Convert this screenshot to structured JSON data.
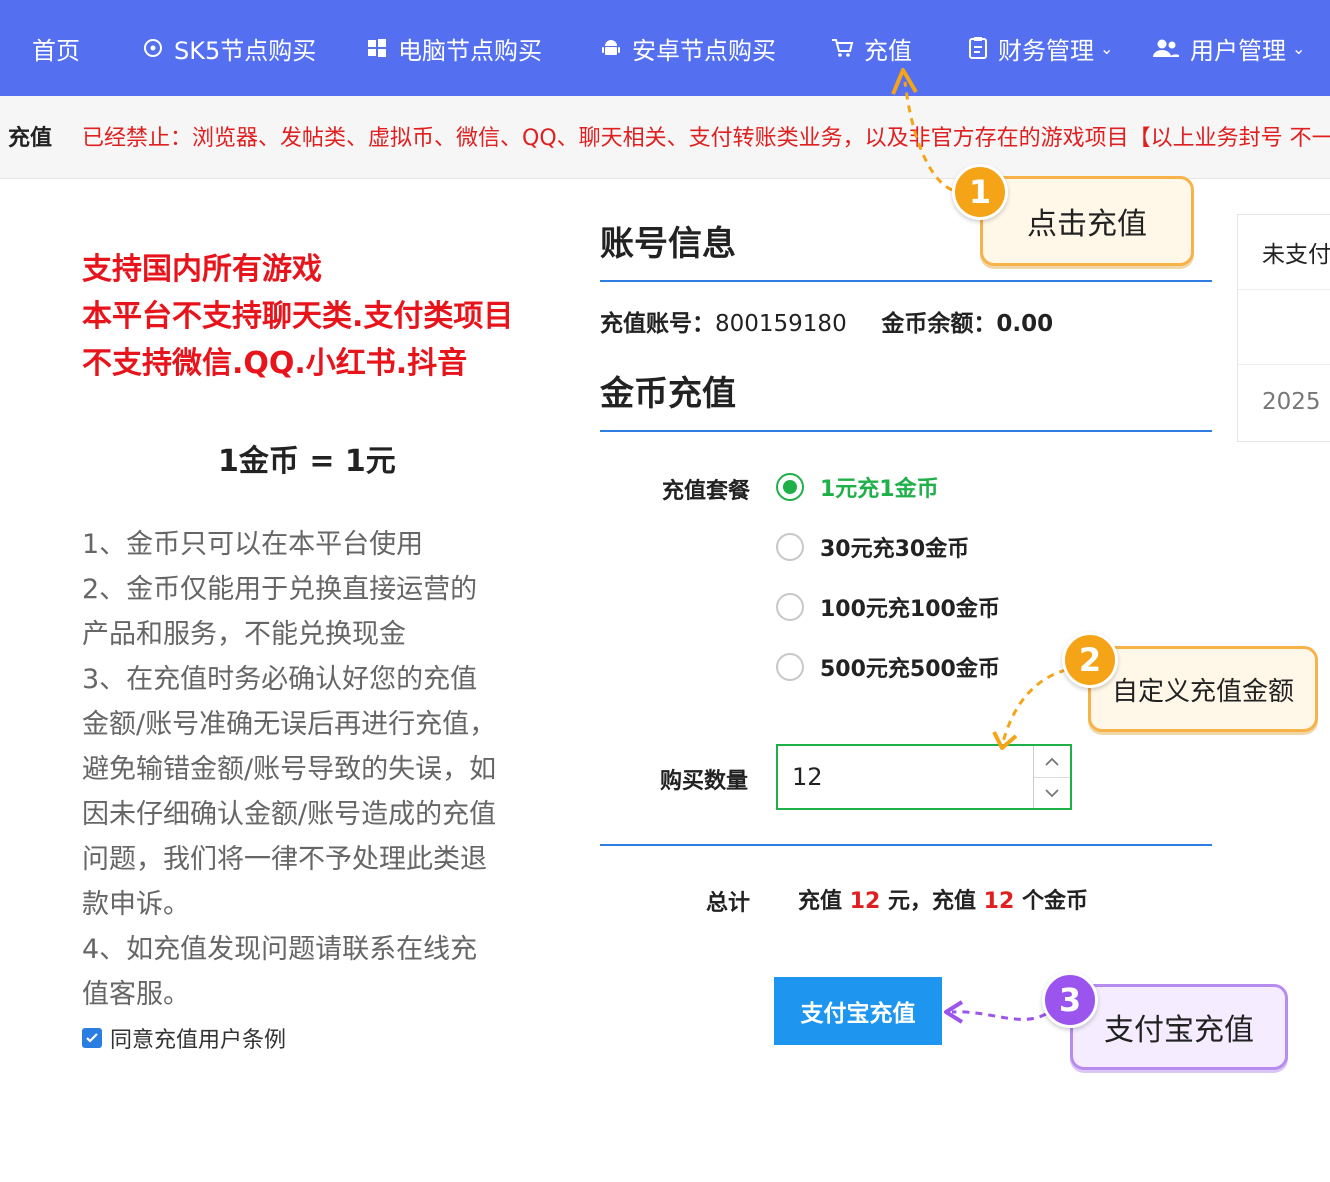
{
  "nav": {
    "items": [
      {
        "label": "首页",
        "icon": ""
      },
      {
        "label": "SK5节点购买",
        "icon": "sync-icon"
      },
      {
        "label": "电脑节点购买",
        "icon": "windows-icon"
      },
      {
        "label": "安卓节点购买",
        "icon": "android-icon"
      },
      {
        "label": "充值",
        "icon": "cart-icon"
      },
      {
        "label": "财务管理",
        "icon": "clipboard-icon",
        "has_dropdown": true
      },
      {
        "label": "用户管理",
        "icon": "users-icon",
        "has_dropdown": true
      }
    ],
    "bg_color": "#5470f0"
  },
  "notice": {
    "label": "充值",
    "text": "已经禁止：浏览器、发帖类、虚拟币、微信、QQ、聊天相关、支付转账类业务，以及非官方存在的游戏项目【以上业务封号 不一"
  },
  "left": {
    "promo": [
      "支持国内所有游戏",
      "本平台不支持聊天类.支付类项目",
      "不支持微信.QQ.小红书.抖音"
    ],
    "rate": "1金币 = 1元",
    "rules": [
      "1、金币只可以在本平台使用",
      "2、金币仅能用于兑换直接运营的产品和服务，不能兑换现金",
      "3、在充值时务必确认好您的充值金额/账号准确无误后再进行充值，避免输错金额/账号导致的失误，如因未仔细确认金额/账号造成的充值问题，我们将一律不予处理此类退款申诉。",
      "4、如充值发现问题请联系在线充值客服。"
    ],
    "agree_label": "同意充值用户条例",
    "agree_checked": true
  },
  "account": {
    "title": "账号信息",
    "account_label": "充值账号：",
    "account_value": "800159180",
    "balance_label": "金币余额：",
    "balance_value": "0.00"
  },
  "recharge": {
    "title": "金币充值",
    "package_label": "充值套餐",
    "options": [
      {
        "label": "1元充1金币",
        "selected": true
      },
      {
        "label": "30元充30金币",
        "selected": false
      },
      {
        "label": "100元充100金币",
        "selected": false
      },
      {
        "label": "500元充500金币",
        "selected": false
      }
    ],
    "qty_label": "购买数量",
    "qty_value": "12",
    "total_label": "总计",
    "total": {
      "prefix": "充值",
      "amount": "12",
      "mid": "元，充值",
      "coins": "12",
      "suffix": "个金币"
    },
    "pay_button": "支付宝充值",
    "accent_green": "#20b04a",
    "accent_blue": "#1e96f0"
  },
  "side_card": {
    "row1": "未支付",
    "row3": "2025"
  },
  "annotations": [
    {
      "number": "1",
      "text": "点击充值"
    },
    {
      "number": "2",
      "text": "自定义充值金额"
    },
    {
      "number": "3",
      "text": "支付宝充值"
    }
  ]
}
